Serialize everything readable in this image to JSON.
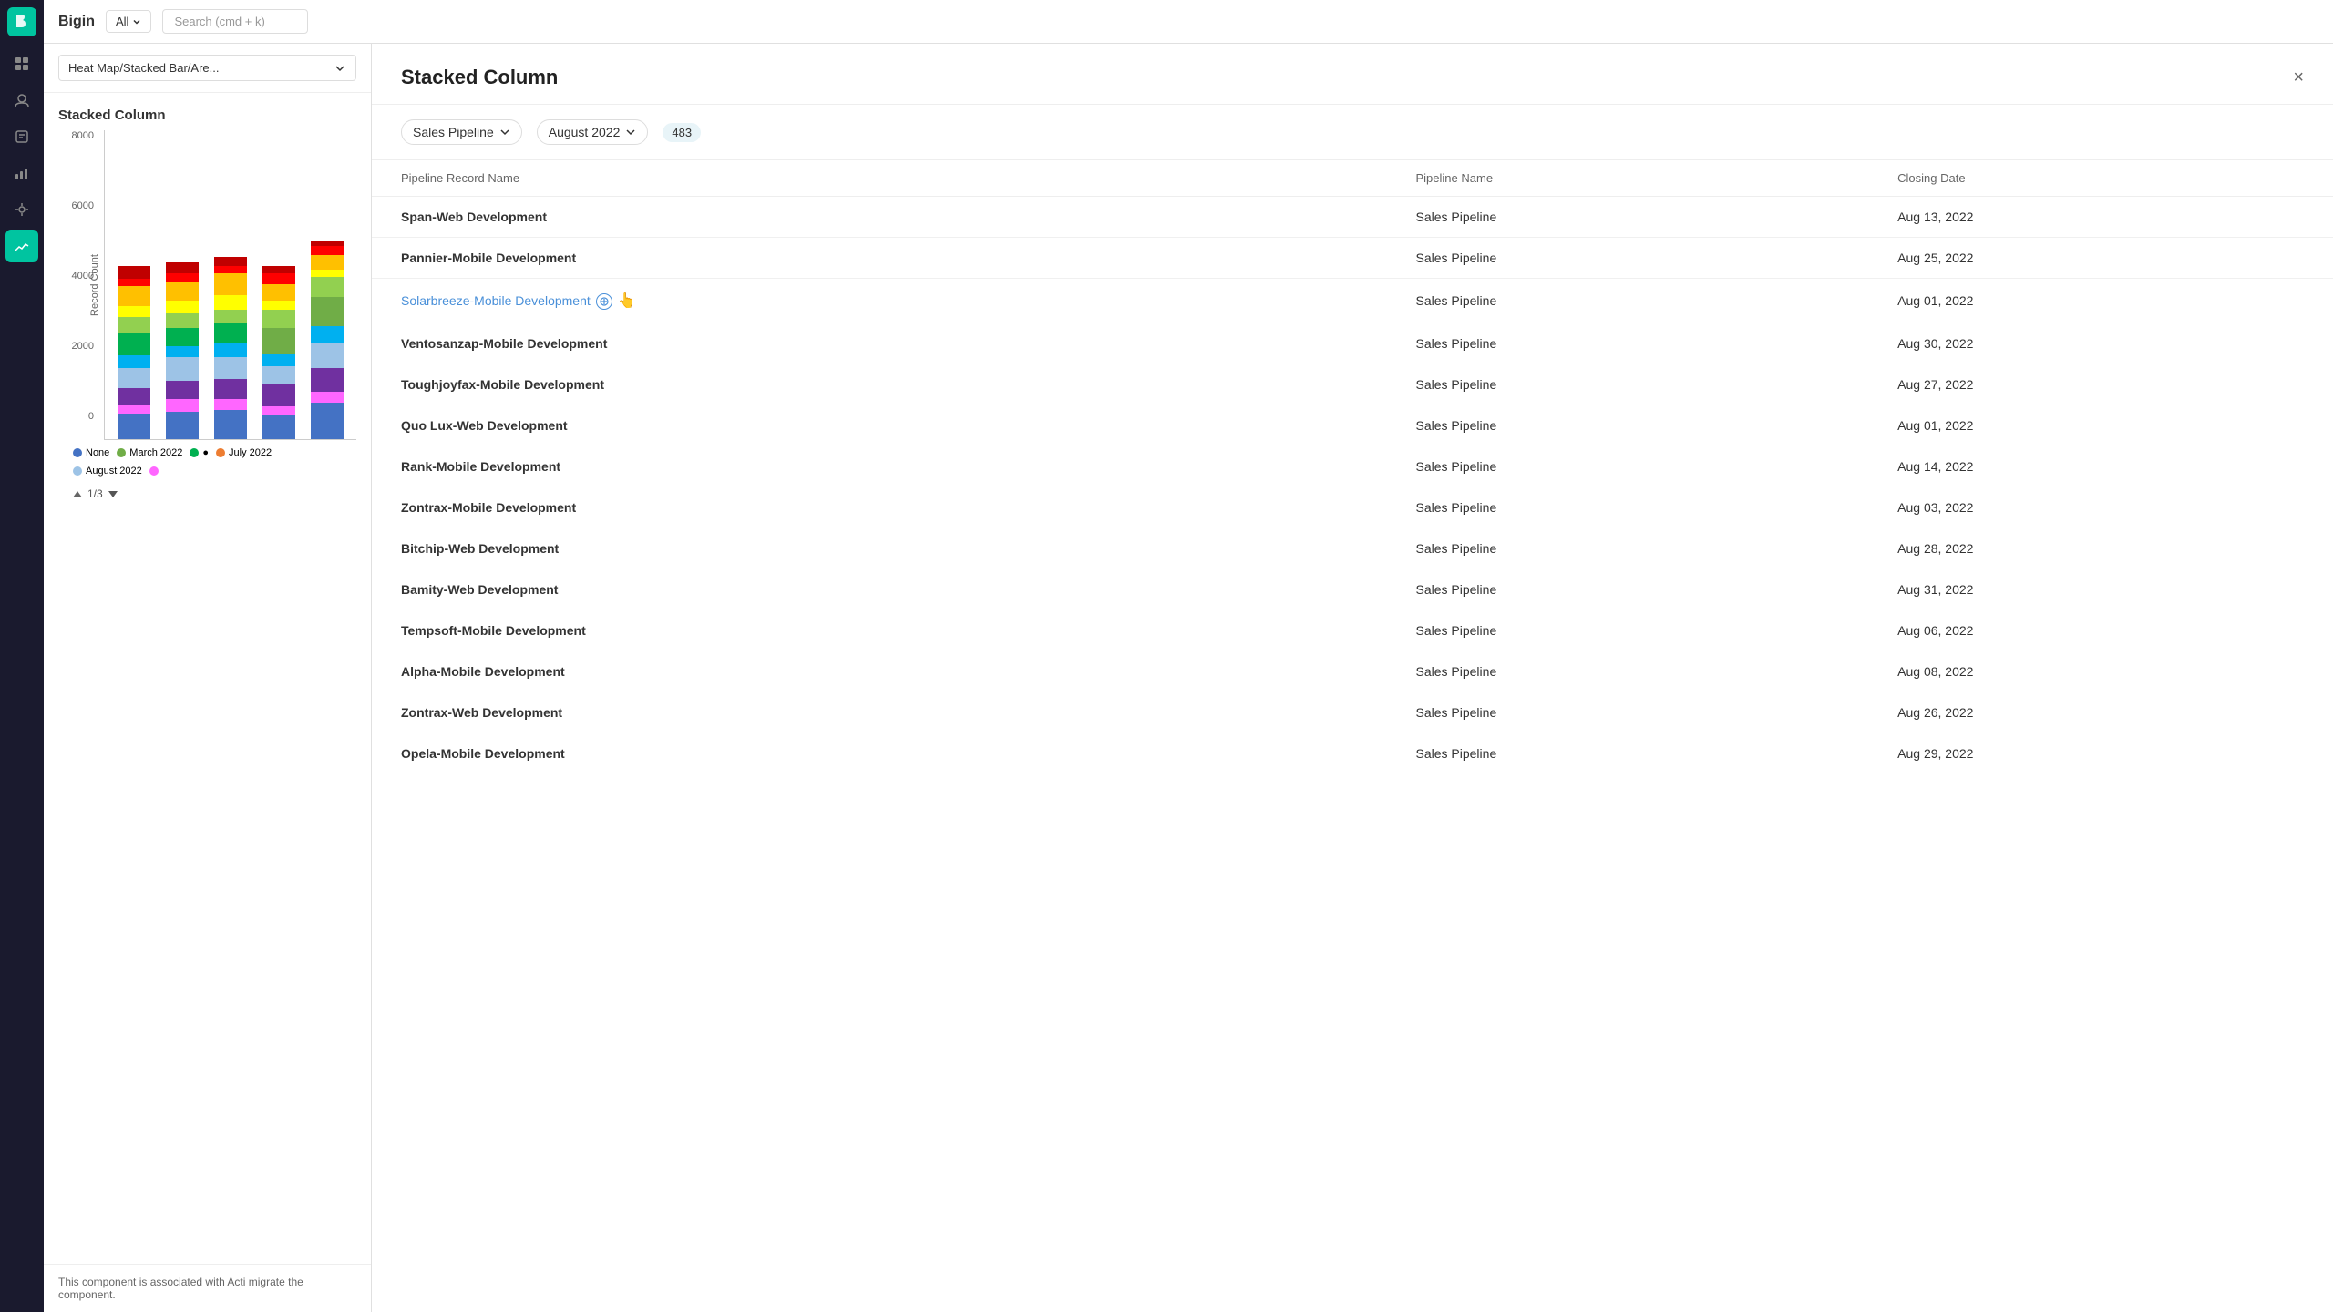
{
  "app": {
    "name": "Bigin",
    "logo": "B"
  },
  "topbar": {
    "all_label": "All",
    "search_placeholder": "Search (cmd + k)"
  },
  "left_panel": {
    "chart_type_label": "Heat Map/Stacked Bar/Are...",
    "chart_title": "Stacked Column",
    "y_axis_label": "Record Count",
    "y_axis_values": [
      "8000",
      "6000",
      "4000",
      "2000",
      "0"
    ],
    "legend_items": [
      {
        "label": "None",
        "color": "#4472c4",
        "shape": "circle"
      },
      {
        "label": "March 2022",
        "color": "#70ad47",
        "shape": "circle"
      },
      {
        "label": "July 2022",
        "color": "#ed7d31",
        "shape": "circle"
      },
      {
        "label": "August 2022",
        "color": "#4472c4",
        "shape": "circle-light"
      }
    ],
    "pagination": "1/3",
    "bottom_note": "This component is associated with Acti migrate the component."
  },
  "modal": {
    "title": "Stacked Column",
    "close_label": "×",
    "filters": {
      "pipeline_label": "Sales Pipeline",
      "date_label": "August 2022",
      "count": "483"
    },
    "table": {
      "columns": [
        "Pipeline Record Name",
        "Pipeline Name",
        "Closing Date"
      ],
      "rows": [
        {
          "name": "Span-Web Development",
          "pipeline": "Sales Pipeline",
          "date": "Aug 13, 2022",
          "is_link": false
        },
        {
          "name": "Pannier-Mobile Development",
          "pipeline": "Sales Pipeline",
          "date": "Aug 25, 2022",
          "is_link": false
        },
        {
          "name": "Solarbreeze-Mobile Development",
          "pipeline": "Sales Pipeline",
          "date": "Aug 01, 2022",
          "is_link": true
        },
        {
          "name": "Ventosanzap-Mobile Development",
          "pipeline": "Sales Pipeline",
          "date": "Aug 30, 2022",
          "is_link": false
        },
        {
          "name": "Toughjoyfax-Mobile Development",
          "pipeline": "Sales Pipeline",
          "date": "Aug 27, 2022",
          "is_link": false
        },
        {
          "name": "Quo Lux-Web Development",
          "pipeline": "Sales Pipeline",
          "date": "Aug 01, 2022",
          "is_link": false
        },
        {
          "name": "Rank-Mobile Development",
          "pipeline": "Sales Pipeline",
          "date": "Aug 14, 2022",
          "is_link": false
        },
        {
          "name": "Zontrax-Mobile Development",
          "pipeline": "Sales Pipeline",
          "date": "Aug 03, 2022",
          "is_link": false
        },
        {
          "name": "Bitchip-Web Development",
          "pipeline": "Sales Pipeline",
          "date": "Aug 28, 2022",
          "is_link": false
        },
        {
          "name": "Bamity-Web Development",
          "pipeline": "Sales Pipeline",
          "date": "Aug 31, 2022",
          "is_link": false
        },
        {
          "name": "Tempsoft-Mobile Development",
          "pipeline": "Sales Pipeline",
          "date": "Aug 06, 2022",
          "is_link": false
        },
        {
          "name": "Alpha-Mobile Development",
          "pipeline": "Sales Pipeline",
          "date": "Aug 08, 2022",
          "is_link": false
        },
        {
          "name": "Zontrax-Web Development",
          "pipeline": "Sales Pipeline",
          "date": "Aug 26, 2022",
          "is_link": false
        },
        {
          "name": "Opela-Mobile Development",
          "pipeline": "Sales Pipeline",
          "date": "Aug 29, 2022",
          "is_link": false
        }
      ]
    }
  },
  "sidebar": {
    "icons": [
      "☰",
      "👤",
      "📋",
      "📊",
      "🔔",
      "⚙️"
    ]
  }
}
